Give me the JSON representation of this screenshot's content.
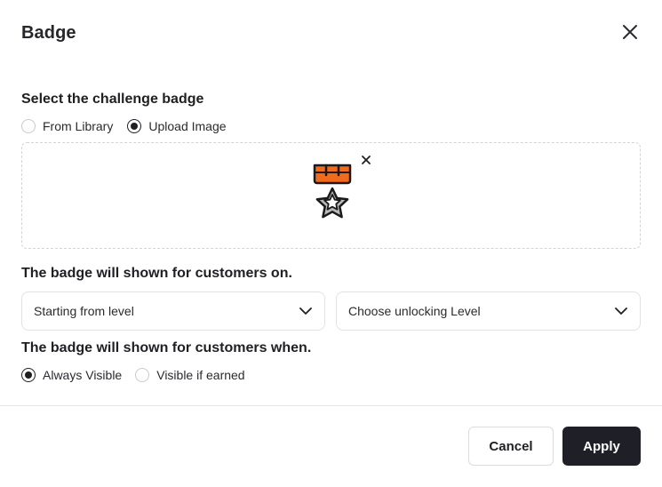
{
  "dialog": {
    "title": "Badge",
    "close_icon": "close-icon"
  },
  "badge_source": {
    "label": "Select the challenge badge",
    "options": [
      {
        "label": "From Library",
        "selected": false
      },
      {
        "label": "Upload Image",
        "selected": true
      }
    ],
    "uploaded_image_icon": "medal-star-icon",
    "remove_icon": "close-icon"
  },
  "levels": {
    "label": "The badge will shown for customers on.",
    "start_select": {
      "value": "Starting from level",
      "icon": "chevron-down-icon"
    },
    "unlock_select": {
      "value": "Choose unlocking Level",
      "icon": "chevron-down-icon"
    }
  },
  "visibility": {
    "label": "The badge will shown for customers when.",
    "options": [
      {
        "label": "Always Visible",
        "selected": true
      },
      {
        "label": "Visible if earned",
        "selected": false
      }
    ]
  },
  "footer": {
    "cancel_label": "Cancel",
    "apply_label": "Apply"
  },
  "colors": {
    "primary": "#1f1f28",
    "medal_ribbon": "#f26a1b",
    "medal_star": "#b9b9b9"
  }
}
